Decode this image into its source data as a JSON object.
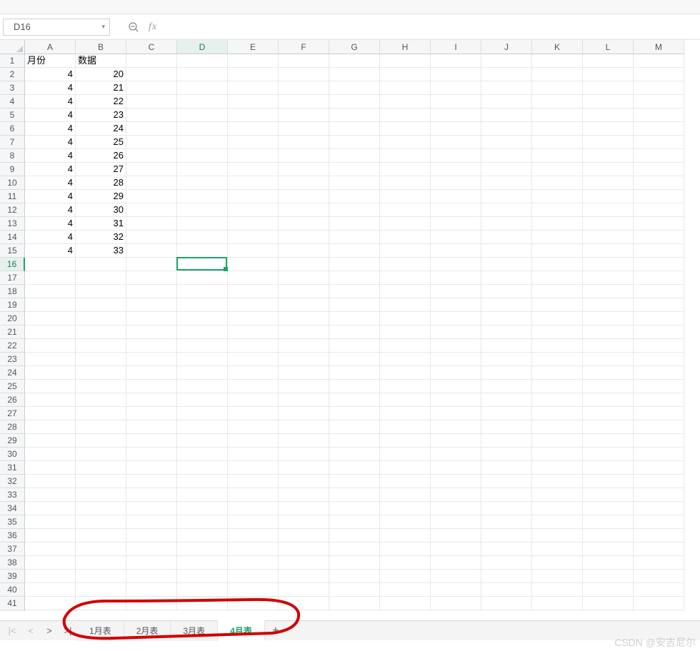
{
  "formula_bar": {
    "cell_ref": "D16",
    "fx_label": "fx",
    "formula_value": ""
  },
  "columns": [
    "A",
    "B",
    "C",
    "D",
    "E",
    "F",
    "G",
    "H",
    "I",
    "J",
    "K",
    "L",
    "M"
  ],
  "active_column_index": 3,
  "active_row_index": 15,
  "row_count": 42,
  "selection": {
    "col": 3,
    "row": 15
  },
  "headers": {
    "colA": "月份",
    "colB": "数据"
  },
  "data_rows": [
    {
      "a": "4",
      "b": "20"
    },
    {
      "a": "4",
      "b": "21"
    },
    {
      "a": "4",
      "b": "22"
    },
    {
      "a": "4",
      "b": "23"
    },
    {
      "a": "4",
      "b": "24"
    },
    {
      "a": "4",
      "b": "25"
    },
    {
      "a": "4",
      "b": "26"
    },
    {
      "a": "4",
      "b": "27"
    },
    {
      "a": "4",
      "b": "28"
    },
    {
      "a": "4",
      "b": "29"
    },
    {
      "a": "4",
      "b": "30"
    },
    {
      "a": "4",
      "b": "31"
    },
    {
      "a": "4",
      "b": "32"
    },
    {
      "a": "4",
      "b": "33"
    }
  ],
  "sheet_tabs": [
    {
      "label": "1月表",
      "active": false
    },
    {
      "label": "2月表",
      "active": false
    },
    {
      "label": "3月表",
      "active": false
    },
    {
      "label": "4月表",
      "active": true
    }
  ],
  "watermark": "CSDN @安吉尼尔"
}
